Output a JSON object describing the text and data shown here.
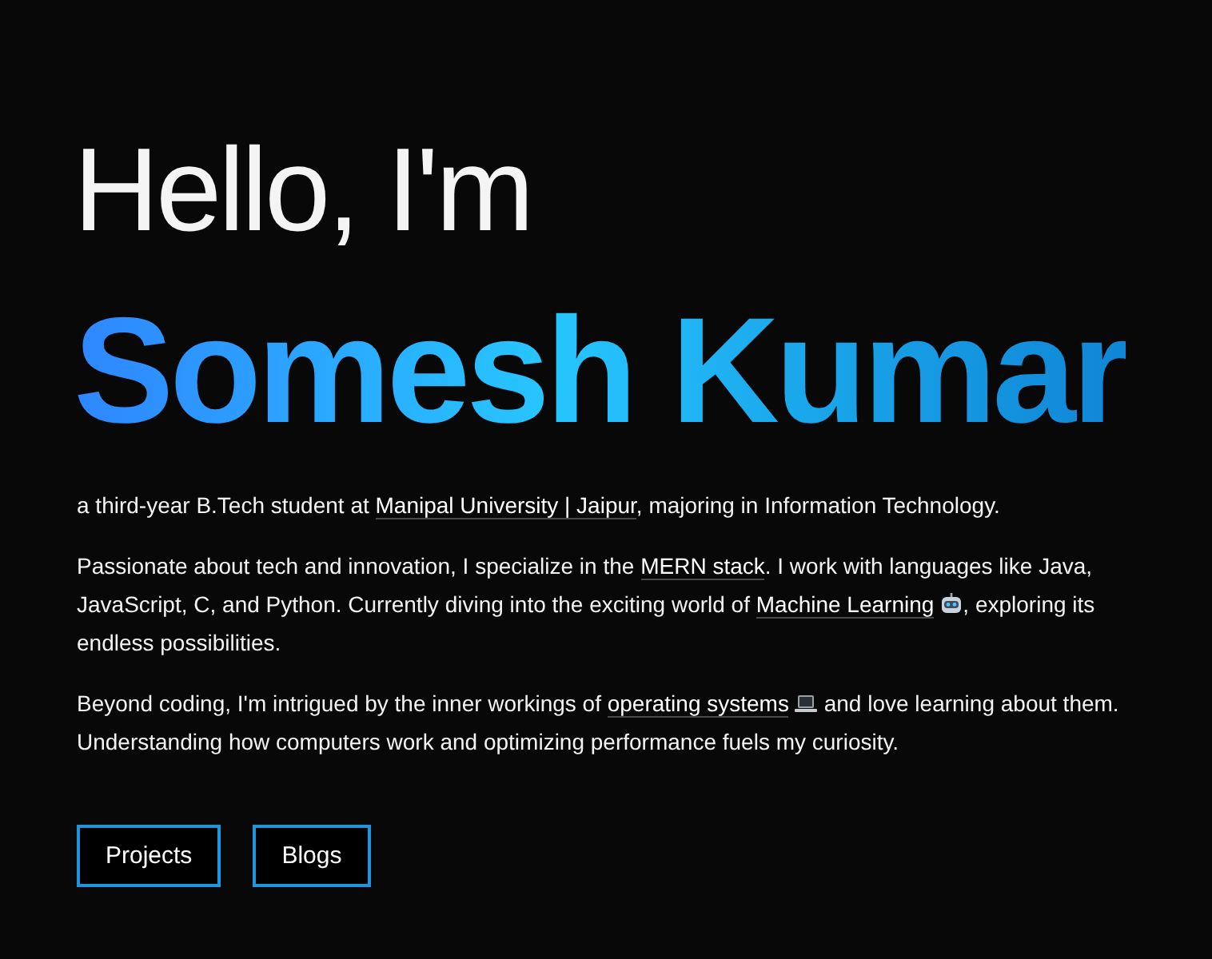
{
  "greeting": "Hello, I'm",
  "name": "Somesh Kumar",
  "paragraphs": [
    {
      "parts": [
        {
          "kind": "text",
          "text": "a third-year B.Tech student at "
        },
        {
          "kind": "link",
          "text": "Manipal University | Jaipur"
        },
        {
          "kind": "text",
          "text": ", majoring in Information Technology."
        }
      ]
    },
    {
      "parts": [
        {
          "kind": "text",
          "text": "Passionate about tech and innovation, I specialize in the "
        },
        {
          "kind": "link",
          "text": "MERN stack"
        },
        {
          "kind": "text",
          "text": ". I work with languages like Java, JavaScript, C, and Python. Currently diving into the exciting world of "
        },
        {
          "kind": "link",
          "text": "Machine Learning"
        },
        {
          "kind": "robot"
        },
        {
          "kind": "text",
          "text": ", exploring its endless possibilities."
        }
      ]
    },
    {
      "parts": [
        {
          "kind": "text",
          "text": "Beyond coding, I'm intrigued by the inner workings of "
        },
        {
          "kind": "link",
          "text": "operating systems"
        },
        {
          "kind": "laptop"
        },
        {
          "kind": "text",
          "text": " and love learning about them. Understanding how computers work and optimizing performance fuels my curiosity."
        }
      ]
    }
  ],
  "buttons": [
    {
      "label": "Projects"
    },
    {
      "label": "Blogs"
    }
  ]
}
